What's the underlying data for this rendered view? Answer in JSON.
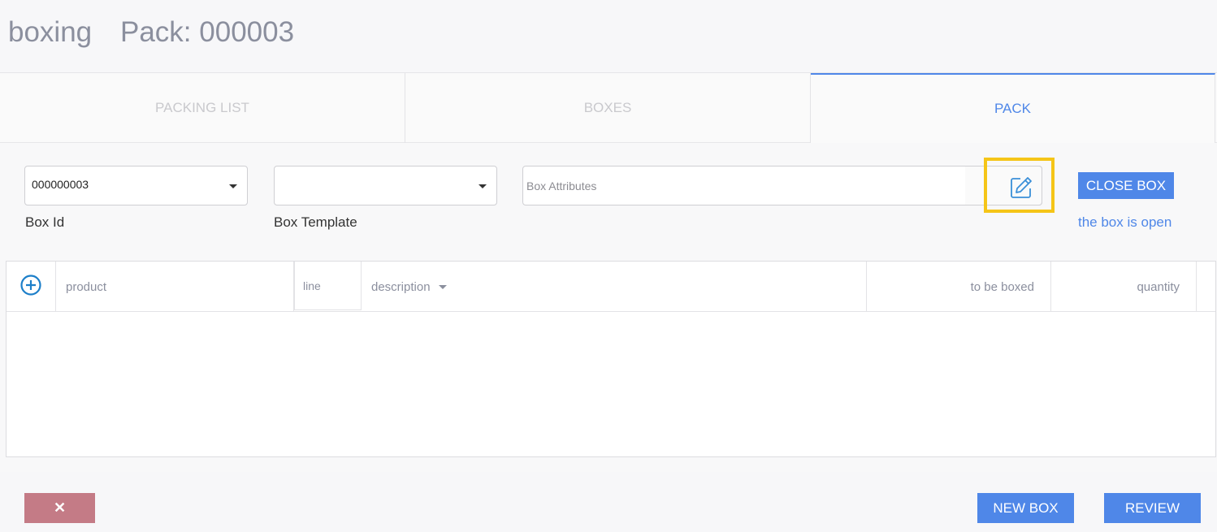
{
  "header": {
    "app_title": "boxing",
    "pack_title": "Pack: 000003"
  },
  "tabs": [
    {
      "label": "PACKING LIST",
      "active": false
    },
    {
      "label": "BOXES",
      "active": false
    },
    {
      "label": "PACK",
      "active": true
    }
  ],
  "form": {
    "box_id": {
      "value": "000000003",
      "label": "Box Id"
    },
    "box_template": {
      "value": "",
      "label": "Box Template"
    },
    "box_attributes": {
      "placeholder": "Box Attributes",
      "edit_icon": "pencil-square-icon"
    }
  },
  "close_box": {
    "label": "CLOSE BOX",
    "status": "the box is open"
  },
  "table": {
    "add_icon": "plus-circle-icon",
    "columns": [
      "product",
      "line",
      "description",
      "to be boxed",
      "quantity"
    ],
    "rows": []
  },
  "footer": {
    "cancel_label": "✕",
    "new_box_label": "NEW BOX",
    "review_label": "REVIEW"
  },
  "colors": {
    "accent": "#4f87e8",
    "cancel": "#c47b86",
    "highlight": "#f5c518"
  }
}
